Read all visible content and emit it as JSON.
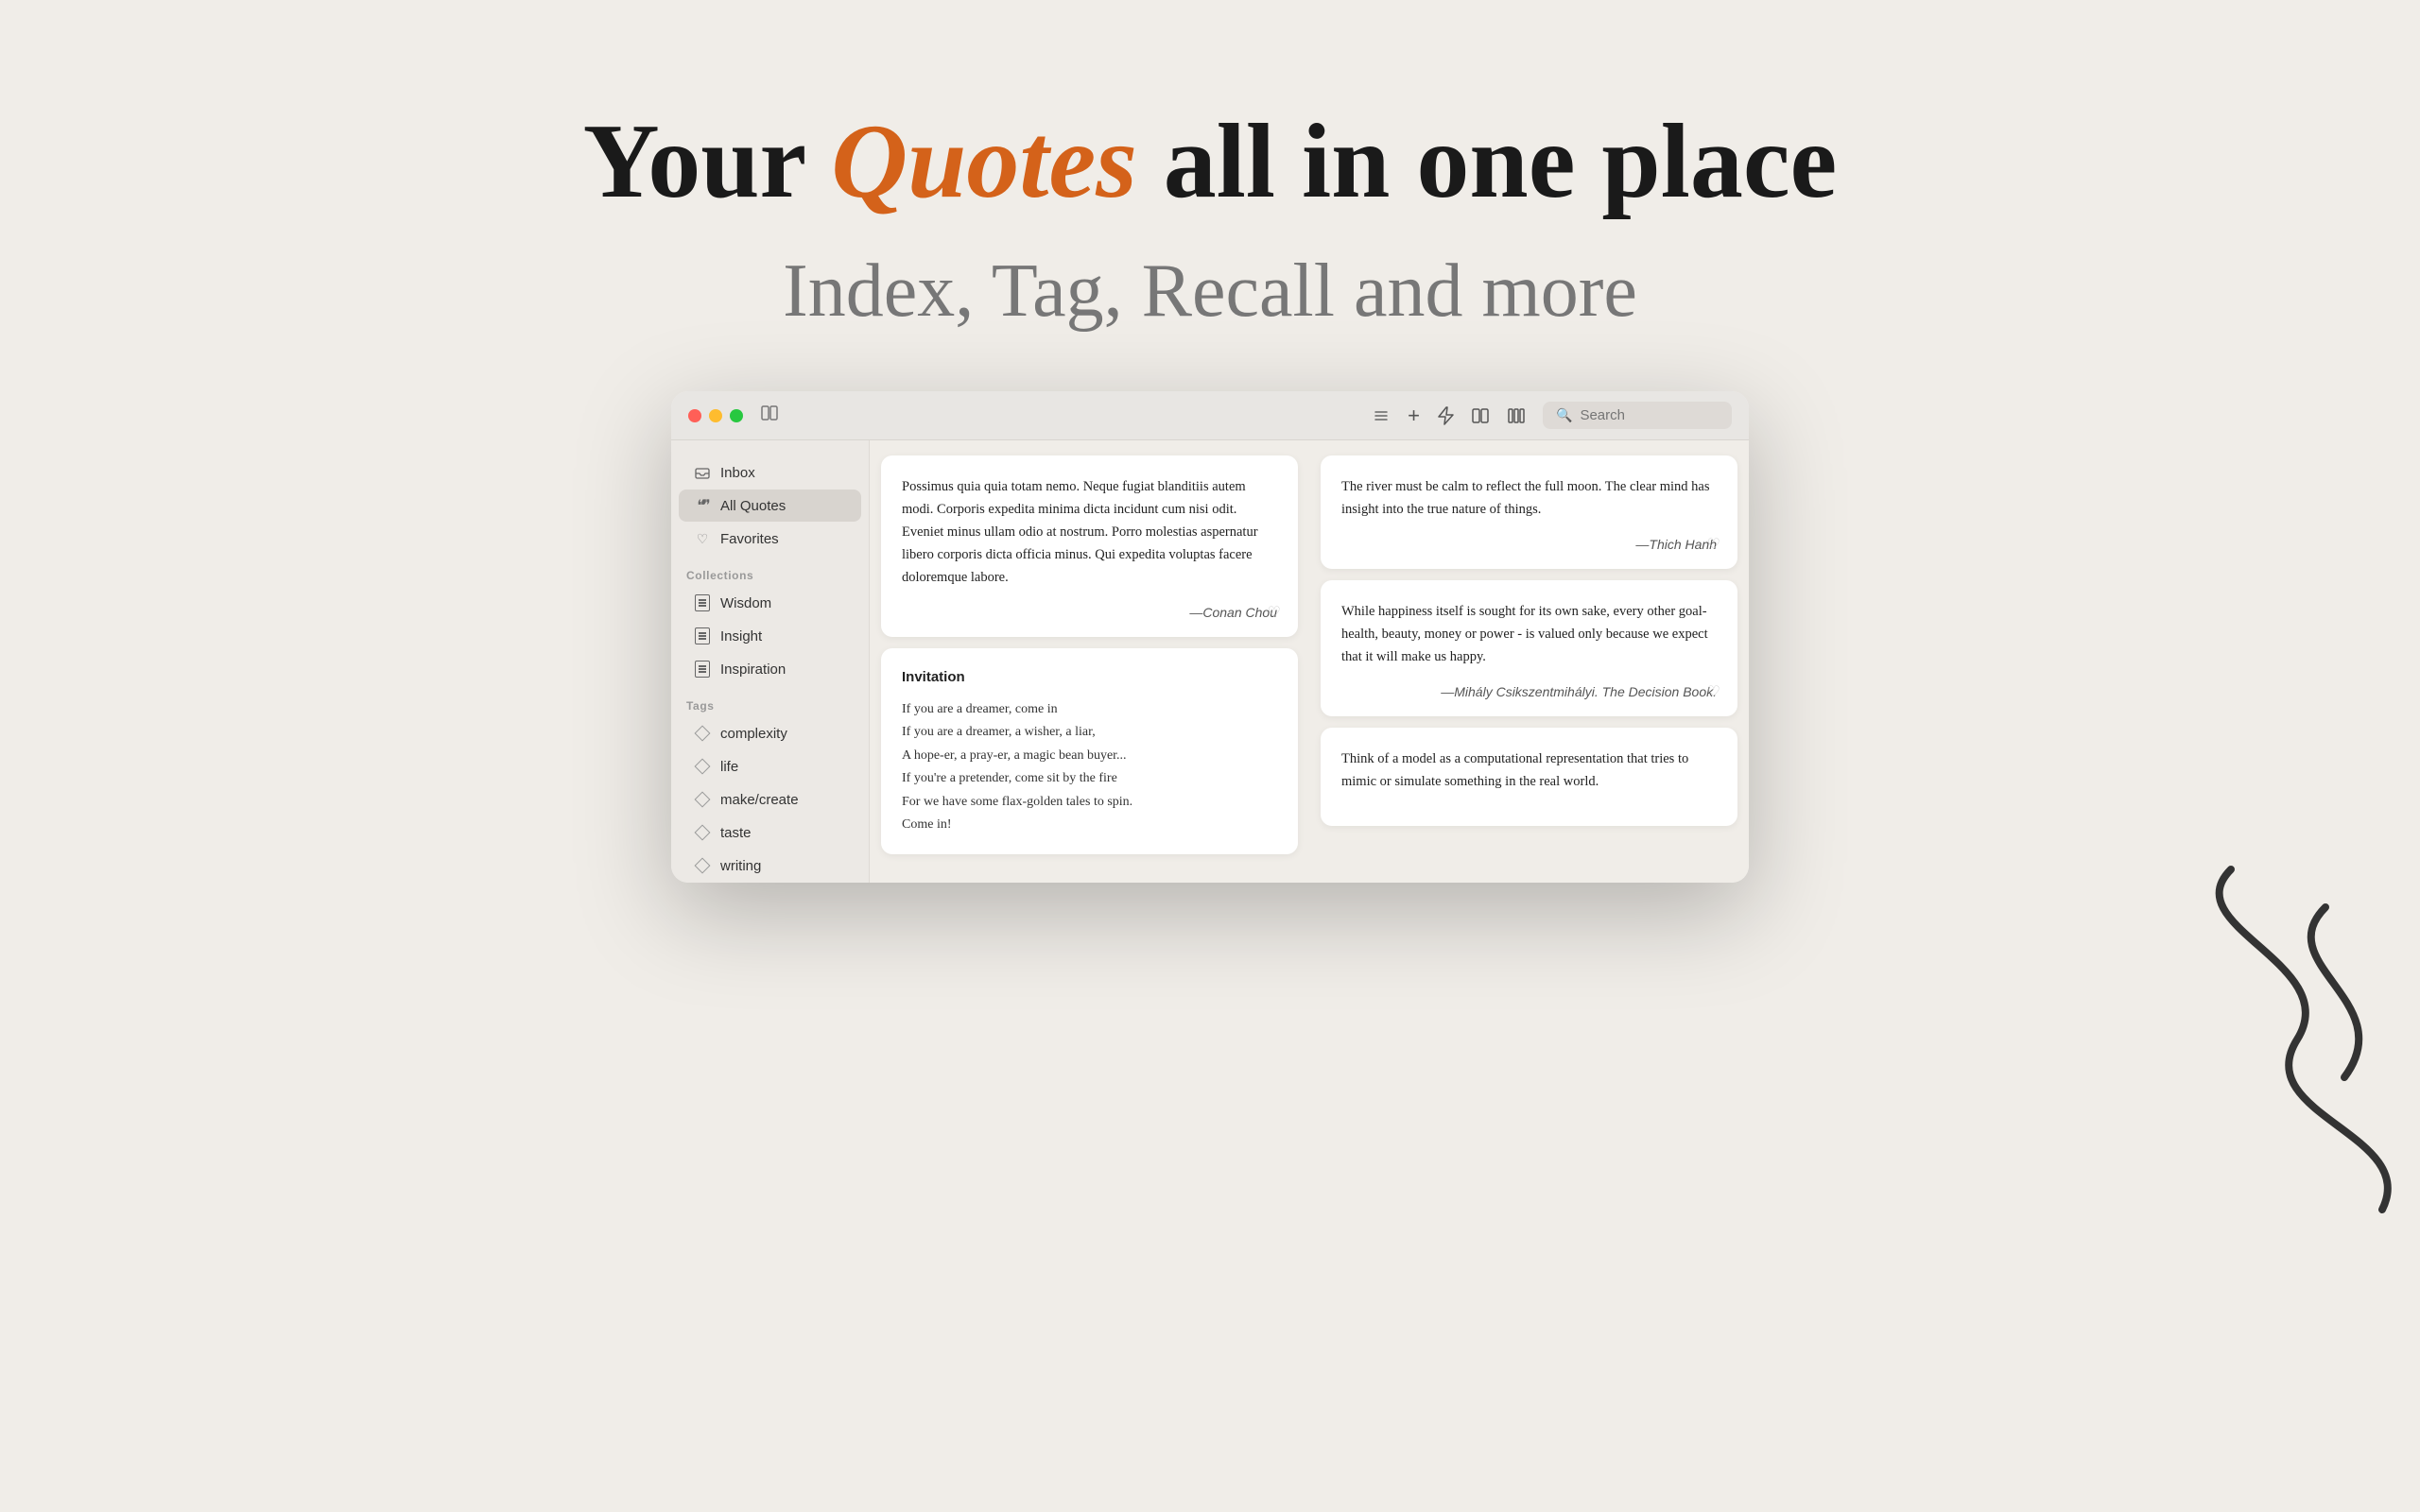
{
  "hero": {
    "title_before": "Your ",
    "title_accent": "Quotes",
    "title_after": " all in one place",
    "subtitle": "Index, Tag, Recall and more"
  },
  "window": {
    "search_placeholder": "Search"
  },
  "sidebar": {
    "inbox_label": "Inbox",
    "all_quotes_label": "All Quotes",
    "favorites_label": "Favorites",
    "collections_label": "Collections",
    "collections": [
      {
        "label": "Wisdom"
      },
      {
        "label": "Insight"
      },
      {
        "label": "Inspiration"
      }
    ],
    "tags_label": "Tags",
    "tags": [
      {
        "label": "complexity"
      },
      {
        "label": "life"
      },
      {
        "label": "make/create"
      },
      {
        "label": "taste"
      },
      {
        "label": "writing"
      }
    ]
  },
  "quotes_left": [
    {
      "text": "Possimus quia quia totam nemo. Neque fugiat blanditiis autem modi. Corporis expedita minima dicta incidunt cum nisi odit. Eveniet minus ullam odio at nostrum. Porro molestias aspernatur libero corporis dicta officia minus. Qui expedita voluptas facere doloremque labore.",
      "author": "—Conan Chou"
    },
    {
      "type": "poem",
      "title": "Invitation",
      "lines": [
        "If you are a dreamer, come in",
        "If you are a dreamer, a wisher, a liar,",
        "A hope-er, a pray-er, a magic bean buyer...",
        "If you're a pretender, come sit by the fire",
        "For we have some flax-golden tales to spin.",
        "Come in!"
      ]
    }
  ],
  "quotes_right": [
    {
      "text": "The river must be calm to reflect the full moon. The clear mind has insight into the true nature of things.",
      "author": "—Thich Hanh"
    },
    {
      "text": "While happiness itself is sought for its own sake, every other goal-health, beauty, money or power - is valued only because we expect that it will make us happy.",
      "author": "—Mihály Csikszentmihályi. The Decision Book."
    },
    {
      "text": "Think of a model as a computational representation that tries to mimic or simulate something in the real world.",
      "author": ""
    }
  ],
  "icons": {
    "list": "≡",
    "lightning": "⚡",
    "card": "▦",
    "columns": "⊞",
    "plus": "+",
    "search": "🔍",
    "inbox": "📥",
    "quotes_double": "❝",
    "heart": "♡",
    "heart_filled": "♥"
  }
}
